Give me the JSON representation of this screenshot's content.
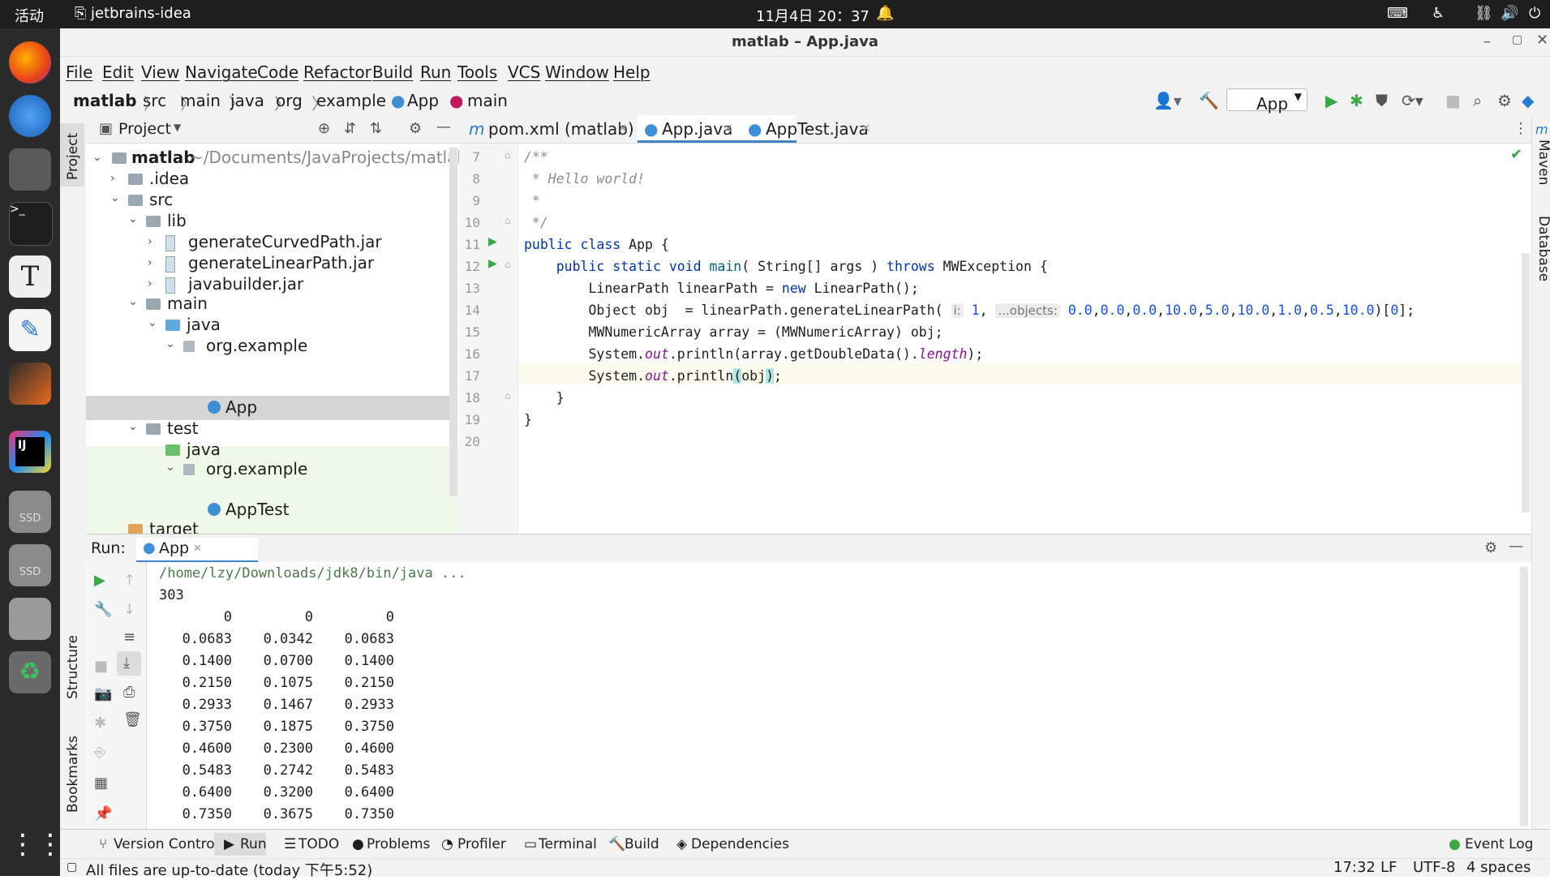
{
  "topbar": {
    "activities": "活动",
    "app": "jetbrains-idea",
    "clock": "11月4日 20：37"
  },
  "dock": {
    "tooltip": "jetbrains-idea",
    "ssd": "SSD"
  },
  "window": {
    "title": "matlab – App.java"
  },
  "menu": [
    "File",
    "Edit",
    "View",
    "Navigate",
    "Code",
    "Refactor",
    "Build",
    "Run",
    "Tools",
    "VCS",
    "Window",
    "Help"
  ],
  "breadcrumb": [
    "matlab",
    "src",
    "main",
    "java",
    "org",
    "example",
    "App",
    "main"
  ],
  "run_config": "App",
  "left_tools": {
    "project": "Project",
    "structure": "Structure",
    "bookmarks": "Bookmarks"
  },
  "right_tools": {
    "maven": "Maven",
    "database": "Database"
  },
  "project": {
    "header": "Project",
    "root": "matlab",
    "root_path": "~/Documents/JavaProjects/matlab",
    "items": [
      ".idea",
      "src",
      "lib",
      "generateCurvedPath.jar",
      "generateLinearPath.jar",
      "javabuilder.jar",
      "main",
      "java",
      "org.example",
      "App",
      "test",
      "java",
      "org.example",
      "AppTest",
      "target"
    ]
  },
  "tabs": [
    "pom.xml (matlab)",
    "App.java",
    "AppTest.java"
  ],
  "code": {
    "line_numbers": [
      "7",
      "8",
      "9",
      "10",
      "11",
      "12",
      "13",
      "14",
      "15",
      "16",
      "17",
      "18",
      "19",
      "20"
    ],
    "hint_i": "i:",
    "hint_objects": "...objects:"
  },
  "run": {
    "label": "Run:",
    "config": "App",
    "cmd": "/home/lzy/Downloads/jdk8/bin/java ...",
    "count": "303",
    "table": [
      [
        "0",
        "0",
        "0"
      ],
      [
        "0.0683",
        "0.0342",
        "0.0683"
      ],
      [
        "0.1400",
        "0.0700",
        "0.1400"
      ],
      [
        "0.2150",
        "0.1075",
        "0.2150"
      ],
      [
        "0.2933",
        "0.1467",
        "0.2933"
      ],
      [
        "0.3750",
        "0.1875",
        "0.3750"
      ],
      [
        "0.4600",
        "0.2300",
        "0.4600"
      ],
      [
        "0.5483",
        "0.2742",
        "0.5483"
      ],
      [
        "0.6400",
        "0.3200",
        "0.6400"
      ],
      [
        "0.7350",
        "0.3675",
        "0.7350"
      ]
    ]
  },
  "bottom_tabs": [
    "Version Control",
    "Run",
    "TODO",
    "Problems",
    "Profiler",
    "Terminal",
    "Build",
    "Dependencies"
  ],
  "event_log": "Event Log",
  "status": {
    "message": "All files are up-to-date (today 下午5:52)",
    "position": "17:32",
    "eol": "LF",
    "encoding": "UTF-8",
    "indent": "4 spaces"
  }
}
